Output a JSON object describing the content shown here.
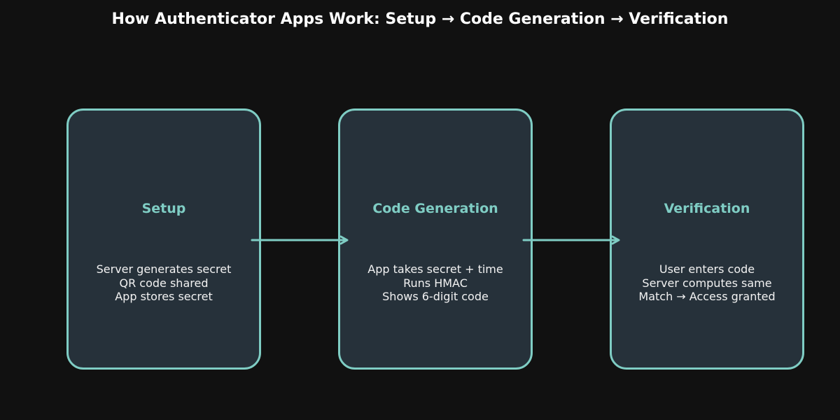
{
  "title": "How Authenticator Apps Work: Setup → Code Generation → Verification",
  "colors": {
    "background": "#111111",
    "card_fill": "#26313a",
    "accent": "#7fcdc4",
    "text": "#f2f2f2"
  },
  "steps": [
    {
      "title": "Setup",
      "lines": [
        "Server generates secret",
        "QR code shared",
        "App stores secret"
      ]
    },
    {
      "title": "Code Generation",
      "lines": [
        "App takes secret + time",
        "Runs HMAC",
        "Shows 6-digit code"
      ]
    },
    {
      "title": "Verification",
      "lines": [
        "User enters code",
        "Server computes same",
        "Match → Access granted"
      ]
    }
  ]
}
